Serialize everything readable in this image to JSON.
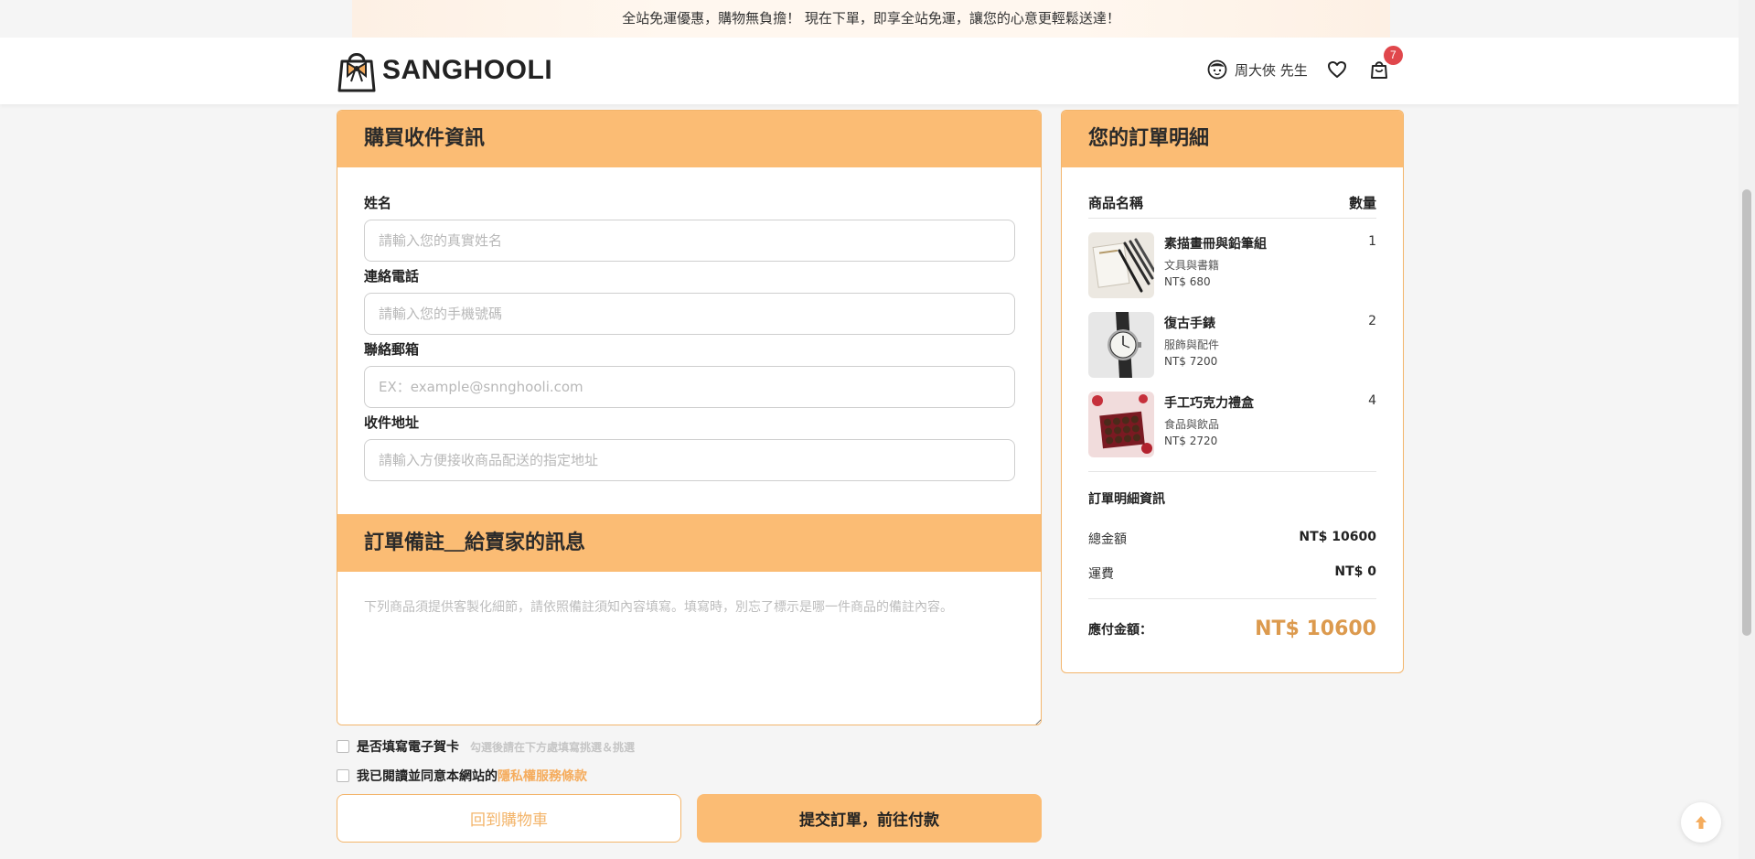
{
  "promo": {
    "text": "全站免運優惠，購物無負擔！ 現在下單，即享全站免運，讓您的心意更輕鬆送達！"
  },
  "header": {
    "logo_text": "SANGHOOLI",
    "user_name": "周大俠 先生",
    "cart_count": "7"
  },
  "form": {
    "title": "購買收件資訊",
    "fields": [
      {
        "label": "姓名",
        "placeholder": "請輸入您的真實姓名",
        "value": ""
      },
      {
        "label": "連絡電話",
        "placeholder": "請輸入您的手機號碼",
        "value": ""
      },
      {
        "label": "聯絡郵箱",
        "placeholder": "EX：example@snnghooli.com",
        "value": ""
      },
      {
        "label": "收件地址",
        "placeholder": "請輸入方便接收商品配送的指定地址",
        "value": ""
      }
    ],
    "note_title": "訂單備註＿給賣家的訊息",
    "note_placeholder": "下列商品須提供客製化細節，請依照備註須知內容填寫。填寫時，別忘了標示是哪一件商品的備註內容。"
  },
  "checks": {
    "ecard_label": "是否填寫電子賀卡",
    "ecard_hint": "勾選後請在下方處填寫挑選＆挑選",
    "agree_label": "我已閱讀並同意本網站的",
    "agree_link": "隱私權服務條款"
  },
  "buttons": {
    "back": "回到購物車",
    "submit": "提交訂單，前往付款"
  },
  "order": {
    "title": "您的訂單明細",
    "col_name": "商品名稱",
    "col_qty": "數量",
    "items": [
      {
        "name": "素描畫冊與鉛筆組",
        "category": "文具與書籍",
        "price": "NT$ 680",
        "qty": "1"
      },
      {
        "name": "復古手錶",
        "category": "服飾與配件",
        "price": "NT$ 7200",
        "qty": "2"
      },
      {
        "name": "手工巧克力禮盒",
        "category": "食品與飲品",
        "price": "NT$ 2720",
        "qty": "4"
      }
    ],
    "summary_title": "訂單明細資訊",
    "total_label": "總金額",
    "total_value": "NT$ 10600",
    "shipping_label": "運費",
    "shipping_value": "NT$ 0",
    "payable_label": "應付金額：",
    "payable_value": "NT$ 10600"
  },
  "colors": {
    "accent": "#fbbc74",
    "accent_border": "#f3b56b",
    "price_text": "#dc9a4e",
    "badge": "#e0474c"
  }
}
